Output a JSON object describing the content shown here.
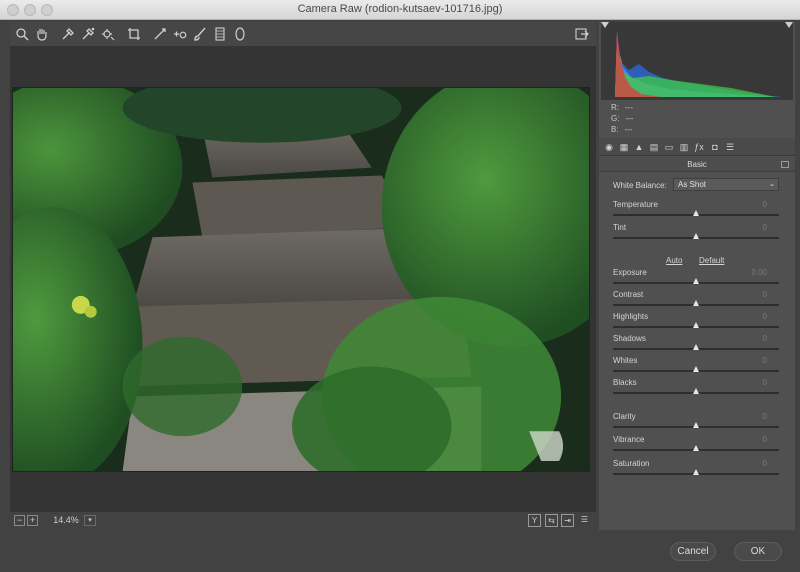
{
  "window": {
    "title": "Camera Raw (rodion-kutsaev-101716.jpg)"
  },
  "toolbar": {
    "tools": [
      "zoom-tool",
      "hand-tool",
      "white-balance-tool",
      "color-sampler-tool",
      "targeted-adjustment-tool",
      "crop-tool",
      "straighten-tool",
      "spot-removal-tool",
      "red-eye-tool",
      "adjustment-brush-tool",
      "graduated-filter-tool",
      "radial-filter-tool"
    ],
    "open_preferences_icon": "export-icon"
  },
  "status": {
    "zoom": "14.4%",
    "zoom_minus": "−",
    "zoom_plus": "+"
  },
  "histogram": {
    "r_label": "R:",
    "r_value": "---",
    "g_label": "G:",
    "g_value": "---",
    "b_label": "B:",
    "b_value": "---"
  },
  "panel": {
    "section_title": "Basic",
    "white_balance_label": "White Balance:",
    "white_balance_value": "As Shot",
    "auto_label": "Auto",
    "default_label": "Default",
    "sliders": [
      {
        "label": "Temperature",
        "value": "0",
        "position": 0.5
      },
      {
        "label": "Tint",
        "value": "0",
        "position": 0.5
      },
      {
        "label": "Exposure",
        "value": "0.00",
        "position": 0.5
      },
      {
        "label": "Contrast",
        "value": "0",
        "position": 0.5
      },
      {
        "label": "Highlights",
        "value": "0",
        "position": 0.5
      },
      {
        "label": "Shadows",
        "value": "0",
        "position": 0.5
      },
      {
        "label": "Whites",
        "value": "0",
        "position": 0.5
      },
      {
        "label": "Blacks",
        "value": "0",
        "position": 0.5
      },
      {
        "label": "Clarity",
        "value": "0",
        "position": 0.5
      },
      {
        "label": "Vibrance",
        "value": "0",
        "position": 0.5
      },
      {
        "label": "Saturation",
        "value": "0",
        "position": 0.5
      }
    ]
  },
  "footer": {
    "cancel_label": "Cancel",
    "ok_label": "OK"
  }
}
